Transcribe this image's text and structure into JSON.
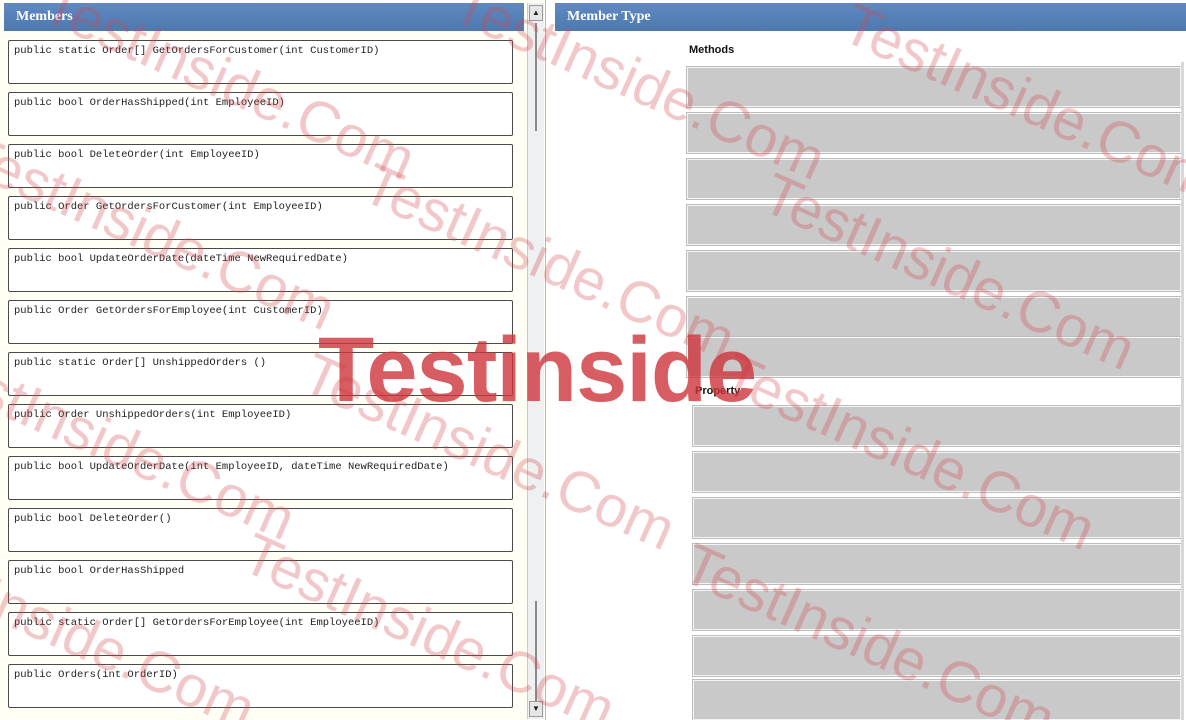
{
  "left_panel": {
    "title": "Members",
    "items": [
      "public static Order[] GetOrdersForCustomer(int CustomerID)",
      "public bool OrderHasShipped(int EmployeeID)",
      "public bool DeleteOrder(int EmployeeID)",
      "public Order GetOrdersForCustomer(int EmployeeID)",
      "public bool UpdateOrderDate(dateTime NewRequiredDate)",
      "public Order GetOrdersForEmployee(int CustomerID)",
      "public static Order[] UnshippedOrders ()",
      "public Order UnshippedOrders(int EmployeeID)",
      "public bool UpdateOrderDate(int EmployeeID, dateTime NewRequiredDate)",
      "public bool DeleteOrder()",
      "public bool OrderHasShipped",
      "public static Order[] GetOrdersForEmployee(int EmployeeID)",
      "public Orders(int OrderID)"
    ]
  },
  "right_panel": {
    "title": "Member Type",
    "methods_label": "Methods",
    "property_label": "Property"
  },
  "watermark": {
    "main": "Testinside",
    "repeat": "TestInside.Com"
  },
  "colors": {
    "header": "#5a84bd",
    "slot": "#c9c9c9",
    "watermark": "#cf3a44"
  }
}
